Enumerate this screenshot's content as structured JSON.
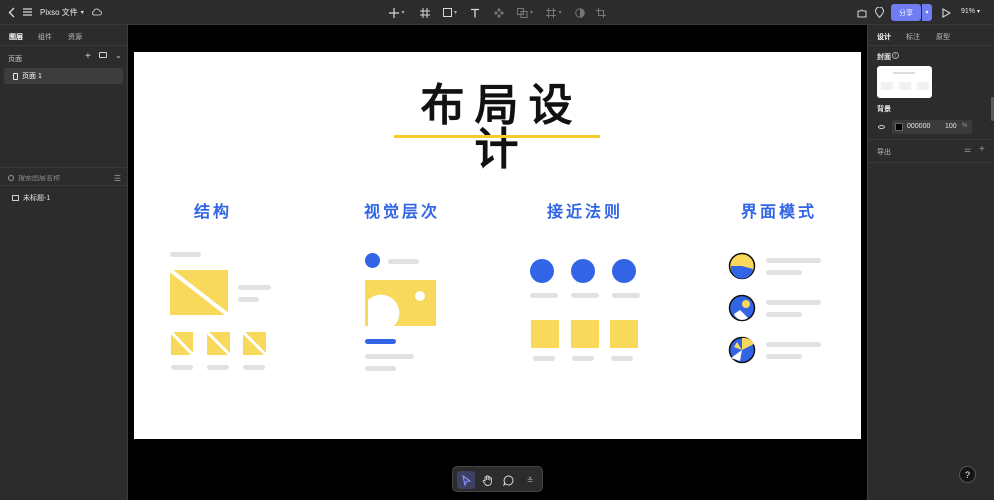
{
  "app": {
    "file_title": "Pixso 文件",
    "share_label": "分享",
    "zoom_label": "91%"
  },
  "toolbar": {
    "icons": [
      "back-icon",
      "menu-icon",
      "cloud-icon",
      "plus-icon",
      "frame-icon",
      "rectangle-icon",
      "text-icon",
      "component-icon",
      "boolean-icon",
      "crop-icon",
      "mask-icon",
      "resize-icon",
      "plugin-icon",
      "pin-icon",
      "play-icon"
    ]
  },
  "left_panel": {
    "tabs": [
      {
        "label": "图层",
        "active": true
      },
      {
        "label": "组件",
        "active": false
      },
      {
        "label": "资源",
        "active": false
      }
    ],
    "pages_label": "页面",
    "pages": [
      {
        "label": "页面 1",
        "selected": true
      }
    ],
    "search_placeholder": "搜索图层名称",
    "layers": [
      {
        "label": "未标题-1"
      }
    ]
  },
  "right_panel": {
    "tabs": [
      {
        "label": "设计",
        "active": true
      },
      {
        "label": "标注",
        "active": false
      },
      {
        "label": "原型",
        "active": false
      }
    ],
    "cover_label": "封面",
    "background_label": "背景",
    "background": {
      "hex": "000000",
      "opacity": "100",
      "unit": "%",
      "color": "#000000"
    },
    "export_label": "导出"
  },
  "artboard": {
    "title": "布局设计",
    "accent_yellow": "#f9d95c",
    "accent_blue": "#3165e6",
    "sections": [
      {
        "title": "结构"
      },
      {
        "title": "视觉层次"
      },
      {
        "title": "接近法则"
      },
      {
        "title": "界面模式"
      }
    ]
  },
  "bottom_toolbar": {
    "tools": [
      {
        "name": "move-tool",
        "active": true
      },
      {
        "name": "hand-tool",
        "active": false
      },
      {
        "name": "comment-tool",
        "active": false
      },
      {
        "name": "more-tool",
        "active": false
      }
    ]
  }
}
